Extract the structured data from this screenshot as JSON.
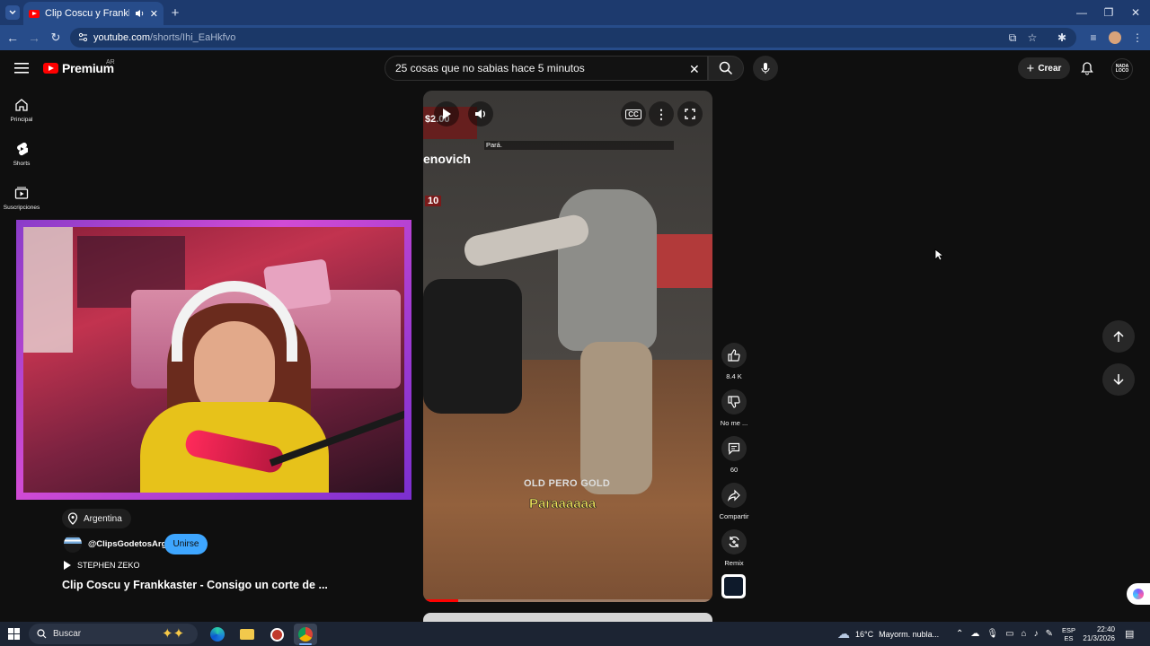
{
  "browser": {
    "tab_title": "Clip Coscu y Frankkaster - C",
    "url_host": "youtube.com",
    "url_path": "/shorts/Ihi_EaHkfvo"
  },
  "youtube": {
    "logo_text": "Premium",
    "country_code": "AR",
    "search_query": "25 cosas que no sabias hace 5 minutos",
    "create_label": "Crear",
    "avatar_text": "NADA LOCO",
    "rail": [
      "Principal",
      "Shorts",
      "Suscripciones"
    ]
  },
  "short": {
    "overlay_price": "$2.00",
    "overlay_name": "enovich",
    "overlay_num": "10",
    "overlay_caption_top": "Pará.",
    "watermark": "OLD PERO GOLD",
    "subtitle": "Paraaaaaa",
    "location": "Argentina",
    "channel_handle": "@ClipsGodetosArg",
    "join_label": "Unirse",
    "music": "STEPHEN ZEKO",
    "title": "Clip Coscu y Frankkaster - Consigo un corte de ..."
  },
  "actions": {
    "likes": "8.4 K",
    "dislike_label": "No me ...",
    "comments": "60",
    "share_label": "Compartir",
    "remix_label": "Remix"
  },
  "taskbar": {
    "search_label": "Buscar",
    "weather_temp": "16°C",
    "weather_text": "Mayorm. nubla...",
    "lang_top": "ESP",
    "lang_bottom": "ES",
    "time": "22:40",
    "date": "21/3/2026"
  },
  "colors": {
    "brand_red": "#ff0000",
    "join_blue": "#3ea6ff",
    "subtitle_yellow": "#f5e85a"
  }
}
